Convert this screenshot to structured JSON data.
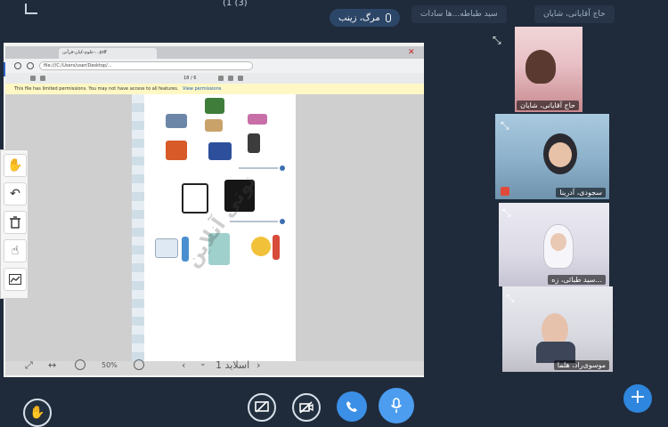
{
  "topbar": {
    "title": "(1 (3)",
    "speaker": "مرگ، زینب",
    "tabs": [
      "سید طباطه...ها سادات",
      "حاج آقایانی، شایان"
    ]
  },
  "share": {
    "browser_tab": "علوم-کیان-قرآنی-...pdf",
    "url": "file:///C:/Users/user/Desktop/...",
    "page_counter": "18 / 6",
    "notice": "This file has limited permissions. You may not have access to all features.",
    "notice_link": "View permissions",
    "watermark": "نوتی آنلاین",
    "slide_label": "اسلاید 1",
    "zoom_label": "50%"
  },
  "participants": [
    {
      "name": "حاج آقایانی، شایان"
    },
    {
      "name": "سجودی، آدرینا"
    },
    {
      "name": "سید طبائی، زه..."
    },
    {
      "name": "موسوی‌راد، هلما"
    }
  ],
  "colors": {
    "background": "#1f2b3b",
    "accent": "#3b8fe6",
    "mic_off": "#e04a3b"
  }
}
